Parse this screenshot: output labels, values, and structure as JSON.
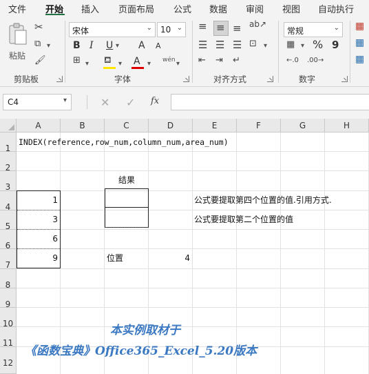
{
  "ribbon_tabs": [
    "文件",
    "开始",
    "插入",
    "页面布局",
    "公式",
    "数据",
    "审阅",
    "视图",
    "自动执行"
  ],
  "ribbon": {
    "clipboard": {
      "paste_label": "粘贴",
      "group_label": "剪贴板"
    },
    "font": {
      "font_name": "宋体",
      "font_size": "10",
      "bold": "B",
      "italic": "I",
      "underline": "U",
      "grow": "A",
      "shrink": "A",
      "wen": "wén",
      "group_label": "字体"
    },
    "alignment": {
      "group_label": "对齐方式"
    },
    "number": {
      "format": "常规",
      "percent": "%",
      "comma": "9",
      "group_label": "数字"
    }
  },
  "formula_bar": {
    "name_box": "C4",
    "fx": "fx",
    "formula": ""
  },
  "columns": [
    "A",
    "B",
    "C",
    "D",
    "E",
    "F",
    "G",
    "H"
  ],
  "rows": [
    "1",
    "2",
    "3",
    "4",
    "5",
    "6",
    "7",
    "8",
    "9",
    "10",
    "11",
    "12"
  ],
  "cells": {
    "A1": "INDEX(reference,row_num,column_num,area_num)",
    "C3": "结果",
    "A4": "1",
    "A5": "3",
    "A6": "6",
    "A7": "9",
    "E4": "公式要提取第四个位置的值.引用方式.",
    "E5": "公式要提取第二个位置的值",
    "C7": "位置",
    "D7": "4"
  },
  "watermark": {
    "line1": "本实例取材于",
    "line2": "《函数宝典》Office365_Excel_5.20版本",
    "color": "#3a78c2"
  },
  "colors": {
    "ribbon_bg": "#f3f3f3",
    "accent": "#217346"
  }
}
